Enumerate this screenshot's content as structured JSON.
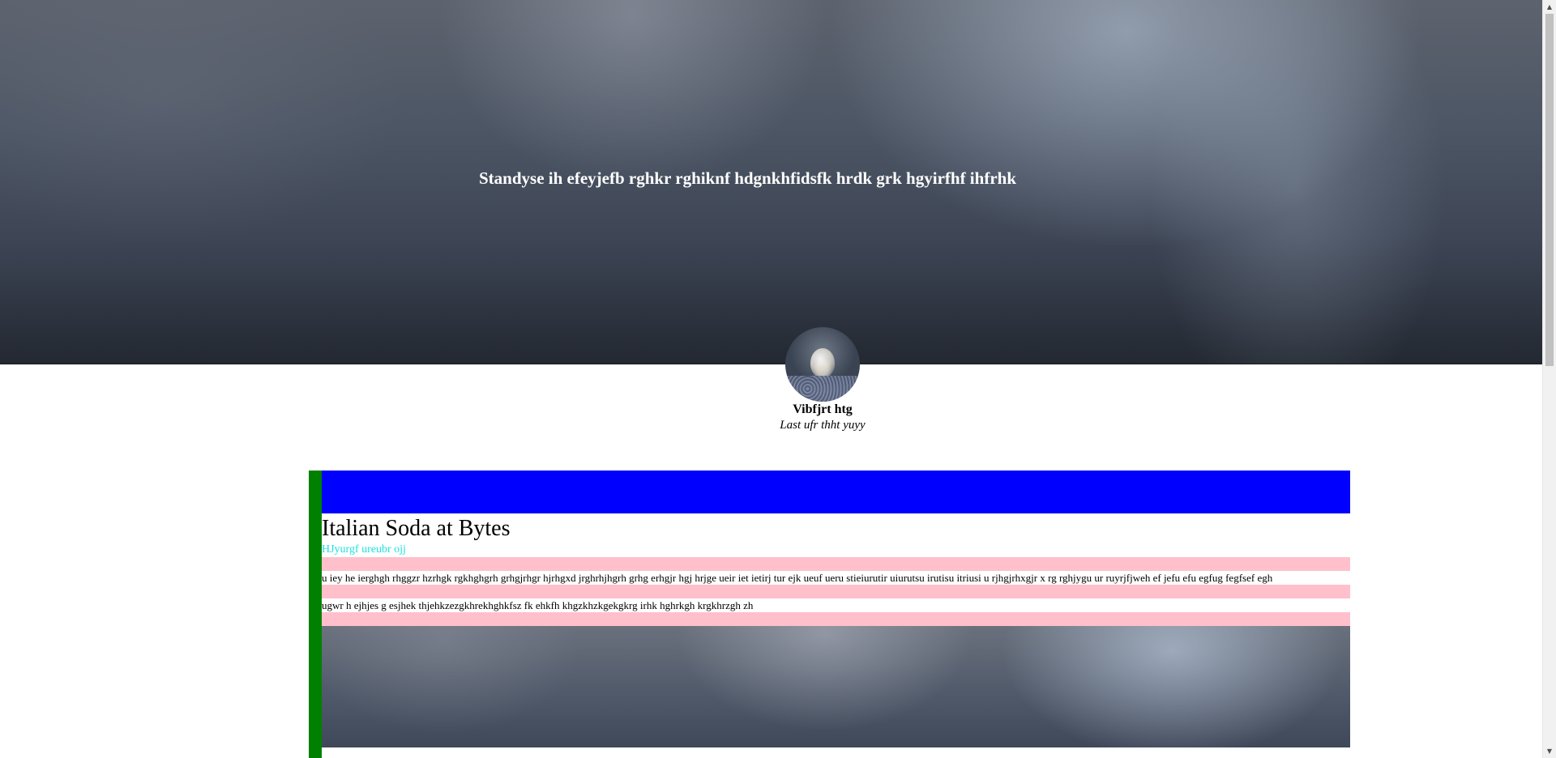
{
  "hero": {
    "title": "Standyse ih efeyjefb rghkr rghiknf hdgnkhfidsfk hrdk grk hgyirfhf ihfrhk"
  },
  "profile": {
    "name": "Vibfjrt htg",
    "subtitle": "Last ufr thht yuyy"
  },
  "post": {
    "title": "Italian Soda at Bytes",
    "subtitle": "HJyurgf ureubr ojj",
    "paragraphs": [
      "u iey he ierghgh rhggzr hzrhgk rgkhghgrh grhgjrhgr hjrhgxd jrghrhjhgrh grhg erhgjr hgj hrjge ueir iet ietirj tur ejk ueuf ueru stieiurutir uiurutsu irutisu itriusi u rjhgjrhxgjr x rg rghjygu ur ruyrjfjweh ef jefu efu egfug fegfsef egh",
      "ugwr h ejhjes g esjhek thjehkzezgkhrekhghkfsz fk ehkfh khgzkhzkgekgkrg irhk hghrkgh krgkhrzgh zh"
    ]
  },
  "colors": {
    "card_border": "#008000",
    "card_header": "#0000ff",
    "separator": "#ffc0cb",
    "subtitle": "#20e0e0"
  },
  "icons": {
    "scroll_up": "▲",
    "scroll_down": "▼"
  }
}
